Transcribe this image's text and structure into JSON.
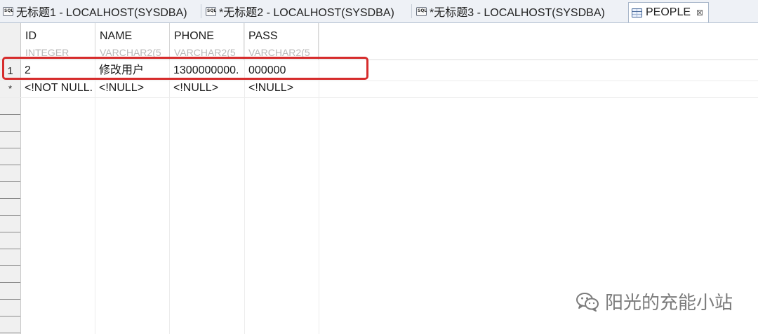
{
  "tabs": [
    {
      "label": "无标题1 - LOCALHOST(SYSDBA)",
      "icon": "sql-file-icon",
      "active": false
    },
    {
      "label": "*无标题2 - LOCALHOST(SYSDBA)",
      "icon": "sql-file-icon",
      "active": false
    },
    {
      "label": "*无标题3 - LOCALHOST(SYSDBA)",
      "icon": "sql-file-icon",
      "active": false
    },
    {
      "label": "PEOPLE",
      "icon": "table-icon",
      "active": true,
      "close": "⊠"
    }
  ],
  "table": {
    "columns": [
      {
        "name": "ID",
        "type": "INTEGER"
      },
      {
        "name": "NAME",
        "type": "VARCHAR2(5"
      },
      {
        "name": "PHONE",
        "type": "VARCHAR2(5"
      },
      {
        "name": "PASS",
        "type": "VARCHAR2(5"
      }
    ],
    "rows": [
      {
        "num": "1",
        "cells": [
          "2",
          "修改用户",
          "1300000000.",
          "000000"
        ]
      },
      {
        "num": "*",
        "cells": [
          "<!NOT NULL.",
          "<!NULL>",
          "<!NULL>",
          "<!NULL>"
        ]
      }
    ]
  },
  "annotation": {
    "color": "#d62c2c"
  },
  "watermark": {
    "text": "阳光的充能小站"
  }
}
